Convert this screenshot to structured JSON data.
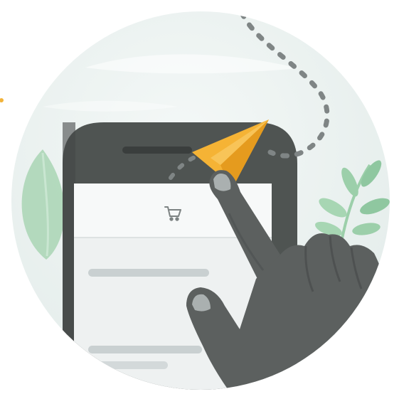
{
  "illustration": {
    "colors": {
      "background_circle": "#e6eeed",
      "background_circle_light": "#f3f7f6",
      "phone_body": "#4f5452",
      "phone_body_dark": "#3c403f",
      "screen": "#eef1f1",
      "screen_header": "#f6f8f8",
      "placeholder_line": "#c9d0d1",
      "paper_plane": "#f5b335",
      "paper_plane_shade": "#e59b1e",
      "hand": "#5c605f",
      "hand_shadow": "#484c4b",
      "fingernail": "#aab0b0",
      "leaf": "#8fc7a0",
      "leaf_light": "#bfe0c8",
      "dotted_path": "#7f8585",
      "accent_dot": "#f2b33a"
    },
    "icons": {
      "cart": "shopping-cart-icon",
      "plane": "paper-plane-icon"
    }
  }
}
